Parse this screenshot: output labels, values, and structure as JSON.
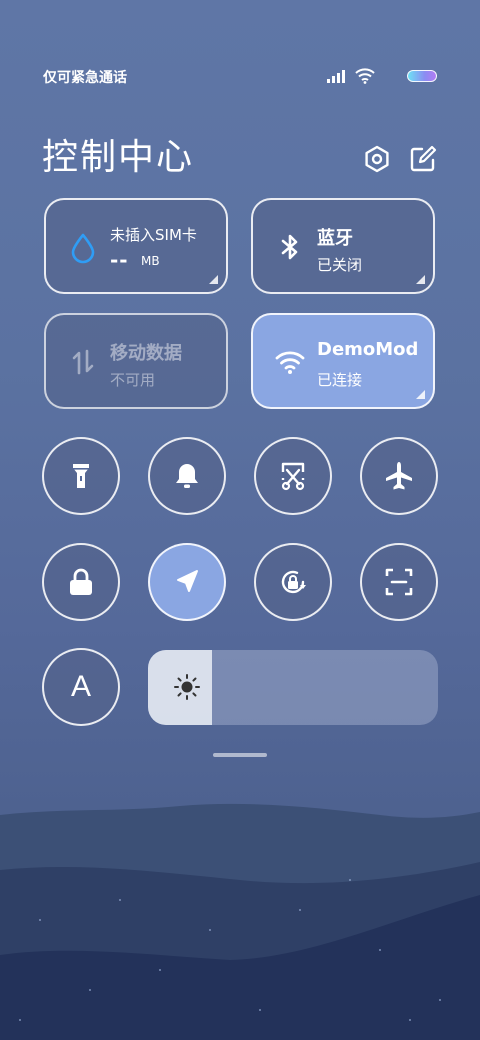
{
  "status_bar": {
    "carrier": "仅可紧急通话",
    "icons": [
      "signal-icon",
      "wifi-icon",
      "battery-icon"
    ]
  },
  "header": {
    "title": "控制中心",
    "icons": [
      "settings-icon",
      "edit-icon"
    ]
  },
  "tiles": [
    {
      "icon": "water-drop-icon",
      "label": "未插入SIM卡",
      "value": "--",
      "unit": "MB"
    },
    {
      "icon": "bluetooth-icon",
      "label": "蓝牙",
      "sub": "已关闭"
    },
    {
      "icon": "mobile-data-icon",
      "label": "移动数据",
      "sub": "不可用",
      "state": "disabled"
    },
    {
      "icon": "wifi-icon",
      "label": "DemoMod",
      "sub": "已连接",
      "state": "active"
    }
  ],
  "toggles_row1": [
    "flashlight-icon",
    "bell-icon",
    "screenshot-icon",
    "airplane-icon"
  ],
  "toggles_row2": [
    "lock-icon",
    "location-icon",
    "rotation-lock-icon",
    "scan-icon"
  ],
  "font_toggle": {
    "letter": "A"
  },
  "brightness": {
    "level": 0.22,
    "icon": "sun-icon"
  },
  "colors": {
    "accent": "#8aa6e2",
    "battery_gradient": [
      "#6ee0f4",
      "#b27bf4"
    ]
  }
}
